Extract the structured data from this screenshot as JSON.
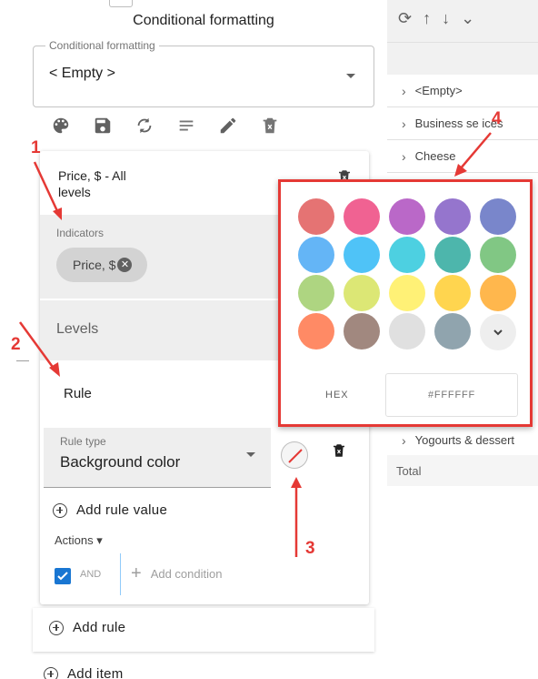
{
  "panel": {
    "title": "Conditional formatting",
    "select": {
      "label": "Conditional formatting",
      "value": "< Empty >"
    },
    "toolbar": [
      {
        "icon": "palette-icon"
      },
      {
        "icon": "save-icon"
      },
      {
        "icon": "sync-icon"
      },
      {
        "icon": "list-icon"
      },
      {
        "icon": "pencil-icon"
      },
      {
        "icon": "delete-icon"
      }
    ]
  },
  "card": {
    "title": "Price, $ - All levels",
    "indicators": {
      "label": "Indicators",
      "chip": "Price, $"
    },
    "levels": "Levels",
    "rule": {
      "heading": "Rule",
      "type_label": "Rule type",
      "type_value": "Background color",
      "add_value": "Add rule value",
      "actions": "Actions",
      "and": "AND",
      "add_condition": "Add condition"
    }
  },
  "add_rule": "Add rule",
  "add_item": "Add item",
  "grid": {
    "header_icons": [
      "⟳",
      "↑",
      "↓",
      "⌄"
    ],
    "rows": [
      "<Empty>",
      "Business se  ices",
      "Cheese",
      "Yogourts & dessert"
    ],
    "total": "Total"
  },
  "picker": {
    "colors": [
      "#e57373",
      "#f06292",
      "#ba68c8",
      "#9575cd",
      "#7986cb",
      "#64b5f6",
      "#4fc3f7",
      "#4dd0e1",
      "#4db6ac",
      "#81c784",
      "#aed581",
      "#dce775",
      "#fff176",
      "#ffd54f",
      "#ffb74d",
      "#ff8a65",
      "#a1887f",
      "#e0e0e0",
      "#90a4ae"
    ],
    "hex_label": "HEX",
    "hex_value": "#FFFFFF"
  },
  "annotations": [
    "1",
    "2",
    "3",
    "4"
  ],
  "annotation_color": "#e53935"
}
